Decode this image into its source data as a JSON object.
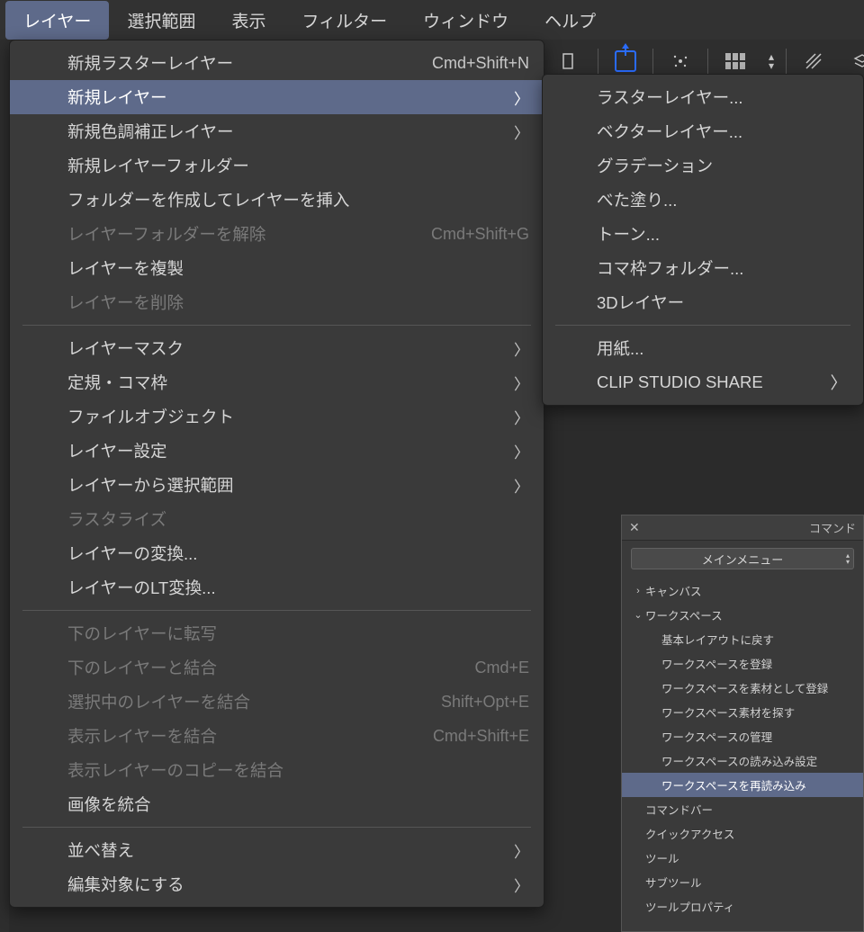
{
  "menubar": {
    "items": [
      {
        "label": "レイヤー",
        "active": true
      },
      {
        "label": "選択範囲"
      },
      {
        "label": "表示"
      },
      {
        "label": "フィルター"
      },
      {
        "label": "ウィンドウ"
      },
      {
        "label": "ヘルプ"
      }
    ]
  },
  "dropdown": {
    "groups": [
      [
        {
          "label": "新規ラスターレイヤー",
          "shortcut": "Cmd+Shift+N"
        },
        {
          "label": "新規レイヤー",
          "submenu": true,
          "highlight": true
        },
        {
          "label": "新規色調補正レイヤー",
          "submenu": true
        },
        {
          "label": "新規レイヤーフォルダー"
        },
        {
          "label": "フォルダーを作成してレイヤーを挿入"
        },
        {
          "label": "レイヤーフォルダーを解除",
          "shortcut": "Cmd+Shift+G",
          "disabled": true
        },
        {
          "label": "レイヤーを複製"
        },
        {
          "label": "レイヤーを削除",
          "disabled": true
        }
      ],
      [
        {
          "label": "レイヤーマスク",
          "submenu": true
        },
        {
          "label": "定規・コマ枠",
          "submenu": true
        },
        {
          "label": "ファイルオブジェクト",
          "submenu": true
        },
        {
          "label": "レイヤー設定",
          "submenu": true
        },
        {
          "label": "レイヤーから選択範囲",
          "submenu": true
        },
        {
          "label": "ラスタライズ",
          "disabled": true
        },
        {
          "label": "レイヤーの変換..."
        },
        {
          "label": "レイヤーのLT変換..."
        }
      ],
      [
        {
          "label": "下のレイヤーに転写",
          "disabled": true
        },
        {
          "label": "下のレイヤーと結合",
          "shortcut": "Cmd+E",
          "disabled": true
        },
        {
          "label": "選択中のレイヤーを結合",
          "shortcut": "Shift+Opt+E",
          "disabled": true
        },
        {
          "label": "表示レイヤーを結合",
          "shortcut": "Cmd+Shift+E",
          "disabled": true
        },
        {
          "label": "表示レイヤーのコピーを結合",
          "disabled": true
        },
        {
          "label": "画像を統合"
        }
      ],
      [
        {
          "label": "並べ替え",
          "submenu": true
        },
        {
          "label": "編集対象にする",
          "submenu": true
        }
      ]
    ]
  },
  "submenu": {
    "groups": [
      [
        {
          "label": "ラスターレイヤー..."
        },
        {
          "label": "ベクターレイヤー..."
        },
        {
          "label": "グラデーション"
        },
        {
          "label": "べた塗り..."
        },
        {
          "label": "トーン..."
        },
        {
          "label": "コマ枠フォルダー..."
        },
        {
          "label": "3Dレイヤー"
        }
      ],
      [
        {
          "label": "用紙..."
        },
        {
          "label": "CLIP STUDIO SHARE",
          "submenu": true
        }
      ]
    ]
  },
  "panel": {
    "title": "コマンド",
    "select_value": "メインメニュー",
    "tree": [
      {
        "label": "キャンバス",
        "depth": 1,
        "toggle": "›"
      },
      {
        "label": "ワークスペース",
        "depth": 1,
        "toggle": "⌄"
      },
      {
        "label": "基本レイアウトに戻す",
        "depth": 2
      },
      {
        "label": "ワークスペースを登録",
        "depth": 2
      },
      {
        "label": "ワークスペースを素材として登録",
        "depth": 2
      },
      {
        "label": "ワークスペース素材を探す",
        "depth": 2
      },
      {
        "label": "ワークスペースの管理",
        "depth": 2
      },
      {
        "label": "ワークスペースの読み込み設定",
        "depth": 2
      },
      {
        "label": "ワークスペースを再読み込み",
        "depth": 2,
        "selected": true
      },
      {
        "label": "コマンドバー",
        "depth": 1
      },
      {
        "label": "クイックアクセス",
        "depth": 1
      },
      {
        "label": "ツール",
        "depth": 1
      },
      {
        "label": "サブツール",
        "depth": 1
      },
      {
        "label": "ツールプロパティ",
        "depth": 1
      }
    ]
  }
}
